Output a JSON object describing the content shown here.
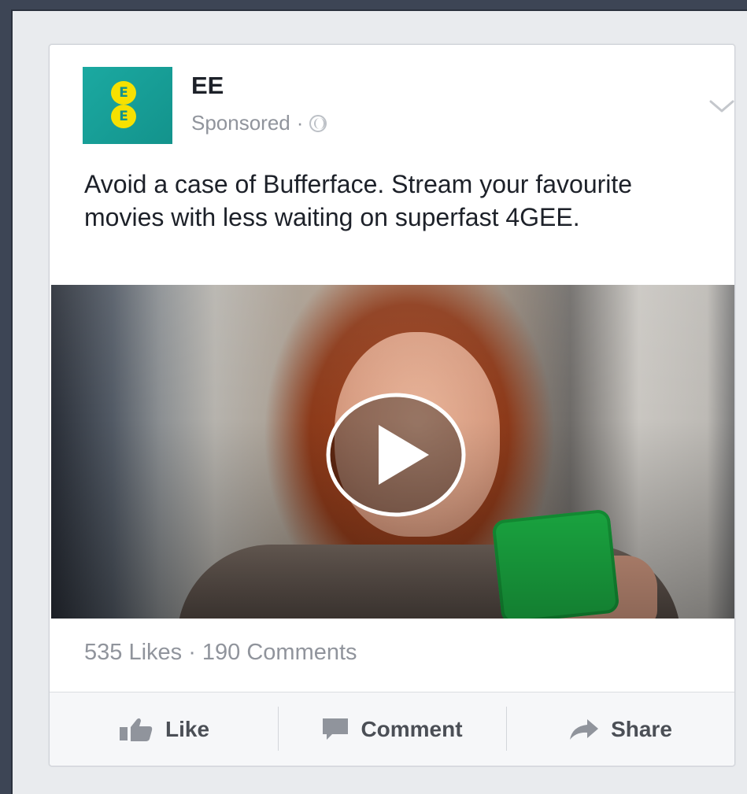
{
  "post": {
    "page_name": "EE",
    "sponsored_label": "Sponsored",
    "separator": "·",
    "logo_letters": [
      "E",
      "E"
    ],
    "message": "Avoid a case of Bufferface. Stream your favourite movies with less waiting on superfast 4GEE.",
    "stats": "535 Likes · 190 Comments",
    "actions": {
      "like": "Like",
      "comment": "Comment",
      "share": "Share"
    }
  },
  "colors": {
    "brand_teal": "#13938c",
    "brand_yellow": "#f6e100",
    "text_primary": "#1d2129",
    "text_secondary": "#90949c",
    "action_text": "#4b4f56",
    "phone_green": "#1ec24b"
  },
  "icons": {
    "logo": "ee-logo-icon",
    "privacy": "globe-icon",
    "menu": "chevron-down-icon",
    "play": "play-icon",
    "like": "thumbs-up-icon",
    "comment": "comment-bubble-icon",
    "share": "share-arrow-icon"
  }
}
